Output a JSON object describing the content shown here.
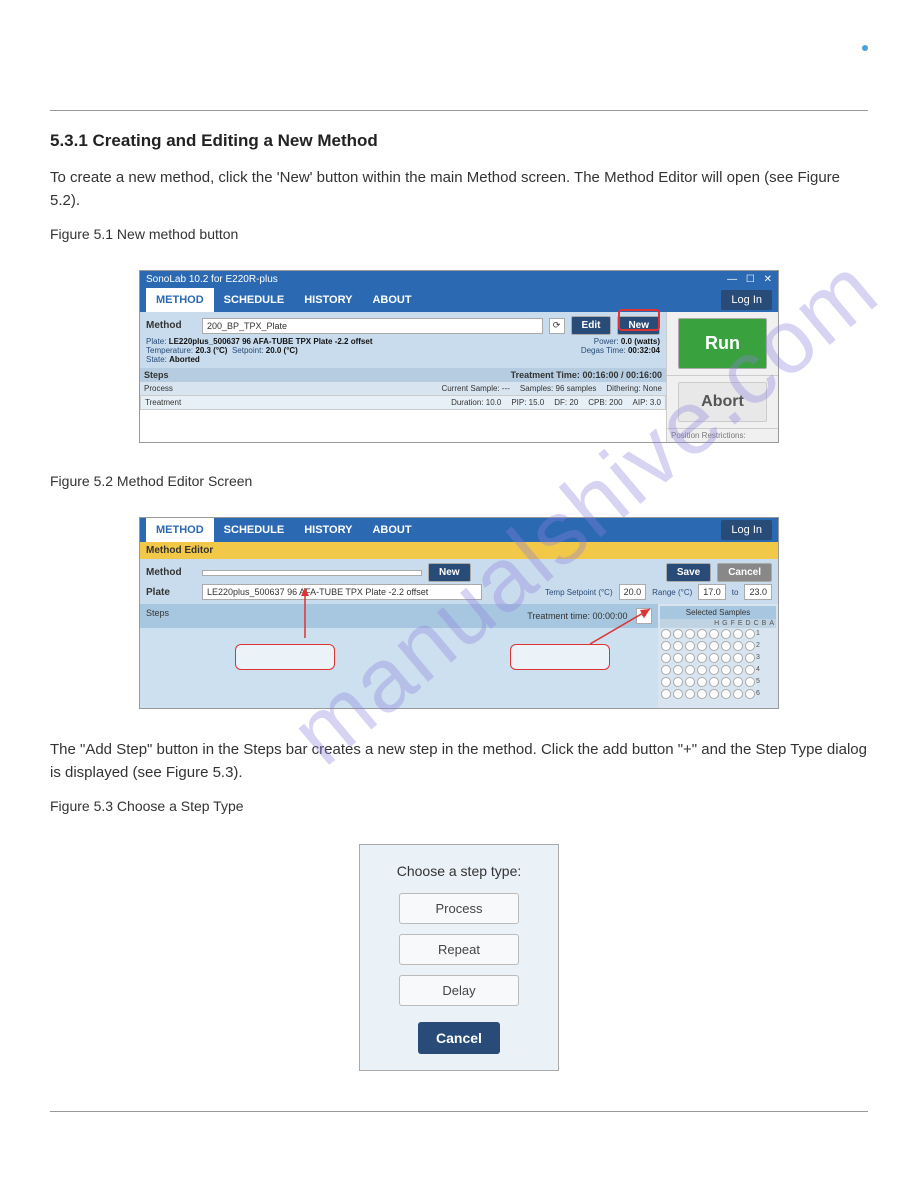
{
  "section_number_title": "5.3.1 Creating and Editing a New Method",
  "intro": "To create a new method, click the 'New' button within the main Method screen. The Method Editor will open (see Figure 5.2).",
  "fig51_caption": "Figure 5.1 New method button",
  "fig52_caption": "Figure 5.2 Method Editor Screen",
  "fig53_intro": "The \"Add Step\" button in the Steps bar creates a new step in the method. Click the add button \"+\" and the Step Type dialog is displayed (see Figure 5.3).",
  "fig53_caption": "Figure 5.3 Choose a Step Type",
  "shot1": {
    "app_title": "SonoLab 10.2 for E220R-plus",
    "tabs": [
      "METHOD",
      "SCHEDULE",
      "HISTORY",
      "ABOUT"
    ],
    "login": "Log In",
    "method_label": "Method",
    "method_value": "200_BP_TPX_Plate",
    "plate_label": "Plate:",
    "plate_value": "LE220plus_500637 96 AFA-TUBE TPX Plate -2.2 offset",
    "temp_label": "Temperature:",
    "temp_value": "20.3 (°C)",
    "setpoint_label": "Setpoint:",
    "setpoint_value": "20.0 (°C)",
    "state_label": "State:",
    "state_value": "Aborted",
    "power_label": "Power:",
    "power_value": "0.0 (watts)",
    "degas_label": "Degas Time:",
    "degas_value": "00:32:04",
    "edit": "Edit",
    "new": "New",
    "run": "Run",
    "abort": "Abort",
    "pos_restrict": "Position Restrictions:",
    "steps_label": "Steps",
    "treatment_time_label": "Treatment Time:",
    "treatment_time_value": "00:16:00 / 00:16:00",
    "process_label": "Process",
    "current_sample": "Current Sample: ---",
    "samples": "Samples: 96 samples",
    "dithering": "Dithering: None",
    "treatment_row": "Treatment",
    "duration": "Duration: 10.0",
    "pip": "PIP: 15.0",
    "df": "DF: 20",
    "cpb": "CPB: 200",
    "aip": "AIP: 3.0"
  },
  "shot2": {
    "tabs": [
      "METHOD",
      "SCHEDULE",
      "HISTORY",
      "ABOUT"
    ],
    "login": "Log In",
    "editor_bar": "Method Editor",
    "method_label": "Method",
    "new": "New",
    "save": "Save",
    "cancel": "Cancel",
    "plate_label": "Plate",
    "plate_value": "LE220plus_500637 96 AFA-TUBE TPX Plate -2.2 offset",
    "temp_setpoint": "Temp Setpoint (°C)",
    "temp_setpoint_val": "20.0",
    "range": "Range (°C)",
    "range_lo": "17.0",
    "range_to": "to",
    "range_hi": "23.0",
    "steps_label": "Steps",
    "treatment_time": "Treatment time: 00:00:00",
    "selected_samples": "Selected Samples",
    "cols": [
      "H",
      "G",
      "F",
      "E",
      "D",
      "C",
      "B",
      "A"
    ],
    "rows": [
      "1",
      "2",
      "3",
      "4",
      "5",
      "6"
    ]
  },
  "dialog": {
    "title": "Choose a step type:",
    "process": "Process",
    "repeat": "Repeat",
    "delay": "Delay",
    "cancel": "Cancel"
  },
  "watermark": "manualshive.com"
}
